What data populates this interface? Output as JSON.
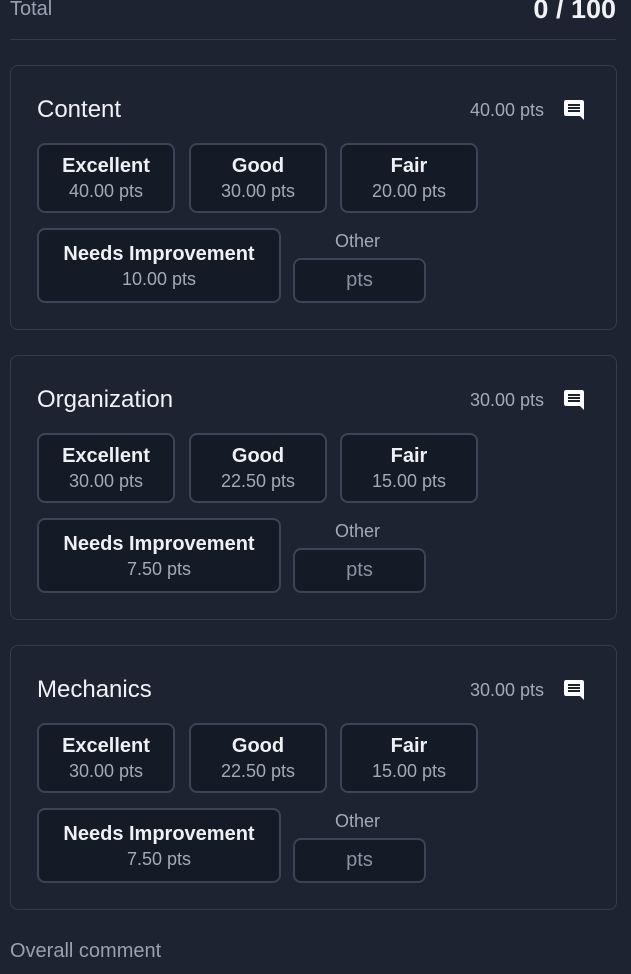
{
  "total": {
    "label": "Total",
    "value": "0 / 100"
  },
  "criteria": [
    {
      "title": "Content",
      "points": "40.00 pts",
      "ratings": [
        {
          "name": "Excellent",
          "pts": "40.00 pts"
        },
        {
          "name": "Good",
          "pts": "30.00 pts"
        },
        {
          "name": "Fair",
          "pts": "20.00 pts"
        },
        {
          "name": "Needs Improvement",
          "pts": "10.00 pts"
        }
      ],
      "other_label": "Other",
      "other_placeholder": "pts"
    },
    {
      "title": "Organization",
      "points": "30.00 pts",
      "ratings": [
        {
          "name": "Excellent",
          "pts": "30.00 pts"
        },
        {
          "name": "Good",
          "pts": "22.50 pts"
        },
        {
          "name": "Fair",
          "pts": "15.00 pts"
        },
        {
          "name": "Needs Improvement",
          "pts": "7.50 pts"
        }
      ],
      "other_label": "Other",
      "other_placeholder": "pts"
    },
    {
      "title": "Mechanics",
      "points": "30.00 pts",
      "ratings": [
        {
          "name": "Excellent",
          "pts": "30.00 pts"
        },
        {
          "name": "Good",
          "pts": "22.50 pts"
        },
        {
          "name": "Fair",
          "pts": "15.00 pts"
        },
        {
          "name": "Needs Improvement",
          "pts": "7.50 pts"
        }
      ],
      "other_label": "Other",
      "other_placeholder": "pts"
    }
  ],
  "overall_comment_label": "Overall comment",
  "icons": {
    "comment": "comment-icon"
  },
  "colors": {
    "background": "#1d2331",
    "card_border": "#343b4b",
    "button_bg": "#141a26"
  }
}
